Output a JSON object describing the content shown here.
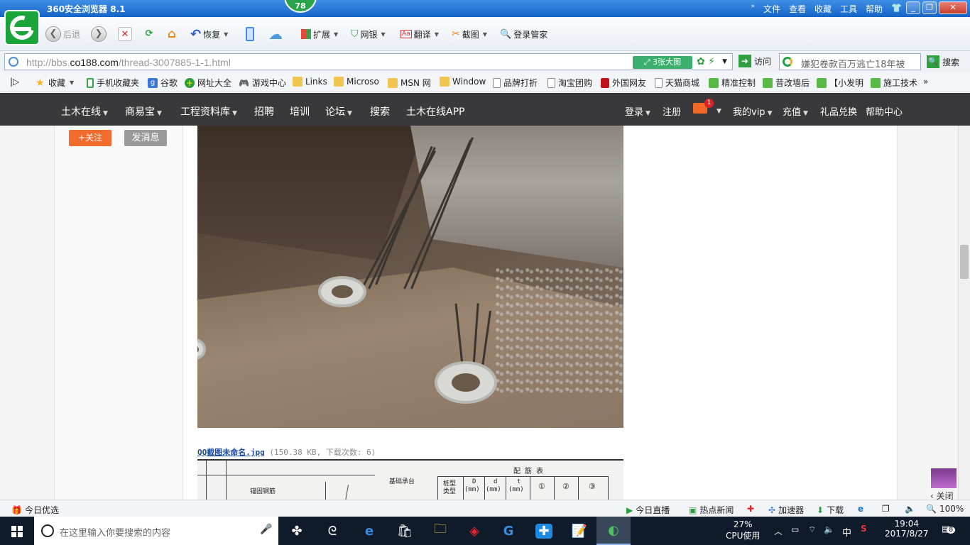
{
  "browser": {
    "title": "360安全浏览器 8.1",
    "badge": "78",
    "menu": [
      "文件",
      "查看",
      "收藏",
      "工具",
      "帮助"
    ]
  },
  "toolbar": {
    "back": "后退",
    "restore": "恢复",
    "extend": "扩展",
    "bank": "网银",
    "translate": "翻译",
    "screenshot": "截图",
    "login_manager": "登录管家"
  },
  "address": {
    "url_prefix": "http://bbs.",
    "url_domain": "co188.com",
    "url_path": "/thread-3007885-1-1.html",
    "big_image_btn": "3张大图",
    "visit": "访问",
    "search_query": "嫌犯卷款百万逃亡18年被",
    "search_btn": "搜索"
  },
  "bookmarks": [
    {
      "label": "收藏",
      "icon": "star"
    },
    {
      "label": "手机收藏夹",
      "icon": "phone"
    },
    {
      "label": "谷歌",
      "icon": "google"
    },
    {
      "label": "网址大全",
      "icon": "plus"
    },
    {
      "label": "游戏中心",
      "icon": "gamepad"
    },
    {
      "label": "Links",
      "icon": "folder"
    },
    {
      "label": "Microso",
      "icon": "folder"
    },
    {
      "label": "MSN 网",
      "icon": "folder"
    },
    {
      "label": "Window",
      "icon": "folder"
    },
    {
      "label": "品牌打折",
      "icon": "page"
    },
    {
      "label": "淘宝团购",
      "icon": "page"
    },
    {
      "label": "外国网友",
      "icon": "red-bookmark"
    },
    {
      "label": "天猫商城",
      "icon": "page"
    },
    {
      "label": "精准控制",
      "icon": "wechat"
    },
    {
      "label": "昔改墙后",
      "icon": "wechat"
    },
    {
      "label": "【小发明",
      "icon": "wechat"
    },
    {
      "label": "施工技术",
      "icon": "wechat"
    }
  ],
  "sitenav": {
    "items": [
      "土木在线",
      "商易宝",
      "工程资料库",
      "招聘",
      "培训",
      "论坛",
      "搜索",
      "土木在线APP"
    ],
    "right": [
      "登录",
      "注册",
      "我的vip",
      "充值",
      "礼品兑换",
      "帮助中心"
    ],
    "mail_count": "1"
  },
  "sidebar": {
    "follow": "+关注",
    "message": "发消息"
  },
  "post": {
    "filename": "QQ截图未命名.jpg",
    "fileinfo": "(150.38 KB, 下载次数: 6)",
    "drawing_title": "配 筋 表",
    "drawing_cols": [
      "桩型",
      "D",
      "d",
      "t",
      "①",
      "②",
      "③"
    ],
    "drawing_units": [
      "(mm)",
      "(mm)",
      "(mm)"
    ],
    "drawing_labels": [
      "锚固钢筋",
      "基础承台"
    ],
    "drawing_col_label": "类型"
  },
  "ad": {
    "close": "关闭"
  },
  "statusbar": {
    "left": "今日优选",
    "live": "今日直播",
    "hotnews": "热点新闻",
    "accelerator": "加速器",
    "download": "下载",
    "zoom": "100%"
  },
  "taskbar": {
    "search_placeholder": "在这里输入你要搜索的内容",
    "cpu_percent": "27%",
    "cpu_label": "CPU使用",
    "ime": "中",
    "time": "19:04",
    "date": "2017/8/27",
    "notif": "8"
  }
}
